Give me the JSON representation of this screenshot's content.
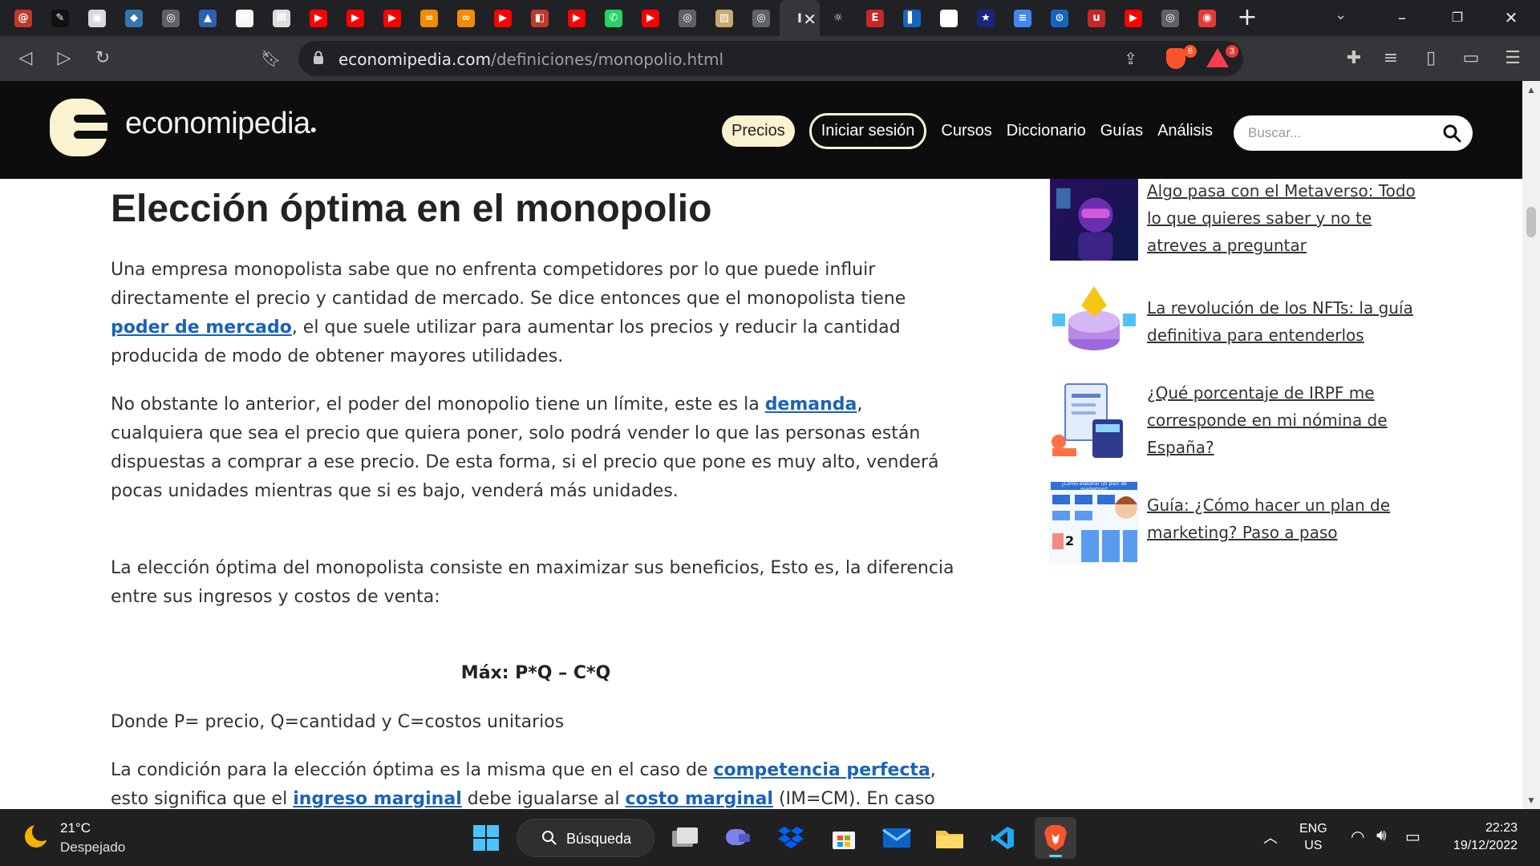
{
  "browser": {
    "tabs": [
      {
        "icon": "at-icon",
        "glyph": "@",
        "color": "#c0392b"
      },
      {
        "icon": "brush-icon",
        "glyph": "✎",
        "color": "#111111"
      },
      {
        "icon": "photo-icon",
        "glyph": "▣",
        "color": "#d9d9d9"
      },
      {
        "icon": "python-icon",
        "glyph": "◆",
        "color": "#3776ab"
      },
      {
        "icon": "globe-icon",
        "glyph": "◎",
        "color": "#5f6368"
      },
      {
        "icon": "triangle-logo-icon",
        "glyph": "▲",
        "color": "#2d5fb5"
      },
      {
        "icon": "presentation-icon",
        "glyph": "▤",
        "color": "#f5f5f5"
      },
      {
        "icon": "museum-icon",
        "glyph": "Ⅲ",
        "color": "#dddddd"
      },
      {
        "icon": "youtube-icon",
        "glyph": "▶",
        "color": "#ff0000"
      },
      {
        "icon": "youtube-icon",
        "glyph": "▶",
        "color": "#ff0000"
      },
      {
        "icon": "youtube-icon",
        "glyph": "▶",
        "color": "#ff0000"
      },
      {
        "icon": "coursera-icon",
        "glyph": "∞",
        "color": "#f28c00"
      },
      {
        "icon": "coursera-icon",
        "glyph": "∞",
        "color": "#f28c00"
      },
      {
        "icon": "youtube-icon",
        "glyph": "▶",
        "color": "#ff0000"
      },
      {
        "icon": "popcorn-icon",
        "glyph": "◧",
        "color": "#c0392b"
      },
      {
        "icon": "youtube-icon",
        "glyph": "▶",
        "color": "#ff0000"
      },
      {
        "icon": "whatsapp-icon",
        "glyph": "✆",
        "color": "#25d366"
      },
      {
        "icon": "youtube-icon",
        "glyph": "▶",
        "color": "#ff0000"
      },
      {
        "icon": "globe-icon",
        "glyph": "◎",
        "color": "#5f6368"
      },
      {
        "icon": "image-icon",
        "glyph": "▨",
        "color": "#c8a96e"
      },
      {
        "icon": "globe-icon",
        "glyph": "◎",
        "color": "#5f6368"
      },
      {
        "icon": "economipedia-tab-icon",
        "glyph": "I",
        "color": "#35363a",
        "active": true
      },
      {
        "icon": "bulb-icon",
        "glyph": "☼",
        "color": "#202124"
      },
      {
        "icon": "e3-icon",
        "glyph": "E",
        "color": "#c62828"
      },
      {
        "icon": "flag-icon",
        "glyph": "▌",
        "color": "#1565c0"
      },
      {
        "icon": "link-icon",
        "glyph": "⟲",
        "color": "#ffffff"
      },
      {
        "icon": "star-icon",
        "glyph": "★",
        "color": "#1a237e"
      },
      {
        "icon": "docs-icon",
        "glyph": "≡",
        "color": "#4285f4"
      },
      {
        "icon": "search-circle-icon",
        "glyph": "⊙",
        "color": "#1565c0"
      },
      {
        "icon": "ud-icon",
        "glyph": "u",
        "color": "#c62828"
      },
      {
        "icon": "youtube-icon",
        "glyph": "▶",
        "color": "#ff0000"
      },
      {
        "icon": "globe-icon",
        "glyph": "◎",
        "color": "#5f6368"
      },
      {
        "icon": "target-icon",
        "glyph": "◉",
        "color": "#e53935"
      }
    ],
    "url_host": "economipedia.com",
    "url_path": "/definiciones/monopolio.html",
    "shield_count": "6",
    "rewards_count": "3"
  },
  "site": {
    "logo_text": "economipedia",
    "nav": {
      "precios": "Precios",
      "login": "Iniciar sesión",
      "cursos": "Cursos",
      "diccionario": "Diccionario",
      "guias": "Guías",
      "analisis": "Análisis"
    },
    "search_placeholder": "Buscar..."
  },
  "article": {
    "heading": "Elección óptima en el monopolio",
    "p1_a": "Una empresa monopolista sabe que no enfrenta competidores por lo que puede influir directamente el precio y cantidad de mercado. Se dice entonces que el monopolista tiene ",
    "p1_link": "poder de mercado",
    "p1_b": ", el que suele utilizar para aumentar los precios y reducir la cantidad producida de modo de obtener mayores utilidades.",
    "p2_a": "No obstante lo anterior, el poder del monopolio tiene un límite, este es la ",
    "p2_link": "demanda",
    "p2_b": ", cualquiera que sea el precio que quiera poner, solo podrá vender lo que las personas están dispuestas a comprar a ese precio. De esta forma, si el precio que pone es muy alto, venderá pocas unidades mientras que si es bajo, venderá más unidades.",
    "p3": "La elección óptima del monopolista consiste en maximizar sus beneficios, Esto es, la diferencia entre sus ingresos y costos de venta:",
    "formula": "Máx: P*Q – C*Q",
    "p4": "Donde P= precio, Q=cantidad y C=costos unitarios",
    "p5_a": "La condición para la elección óptima es la misma que en el caso de ",
    "p5_link1": "competencia perfecta",
    "p5_b": ", esto significa que el ",
    "p5_link2": "ingreso marginal",
    "p5_c": " debe igualarse al ",
    "p5_link3": "costo marginal",
    "p5_d": " (IM=CM). En caso contrario, el"
  },
  "sidebar": [
    {
      "title": "Algo pasa con el Metaverso: Todo lo que quieres saber y no te atreves a preguntar"
    },
    {
      "title": "La revolución de los NFTs: la guía definitiva para entenderlos"
    },
    {
      "title": "¿Qué porcentaje de IRPF me corresponde en mi nómina de España?"
    },
    {
      "title": "Guía: ¿Cómo hacer un plan de marketing? Paso a paso",
      "thumb_caption": "¿Cómo elaborar un plan de marketing?",
      "thumb_number": "2"
    }
  ],
  "taskbar": {
    "weather_temp": "21°C",
    "weather_desc": "Despejado",
    "search_label": "Búsqueda",
    "lang_1": "ENG",
    "lang_2": "US",
    "time": "22:23",
    "date": "19/12/2022"
  }
}
